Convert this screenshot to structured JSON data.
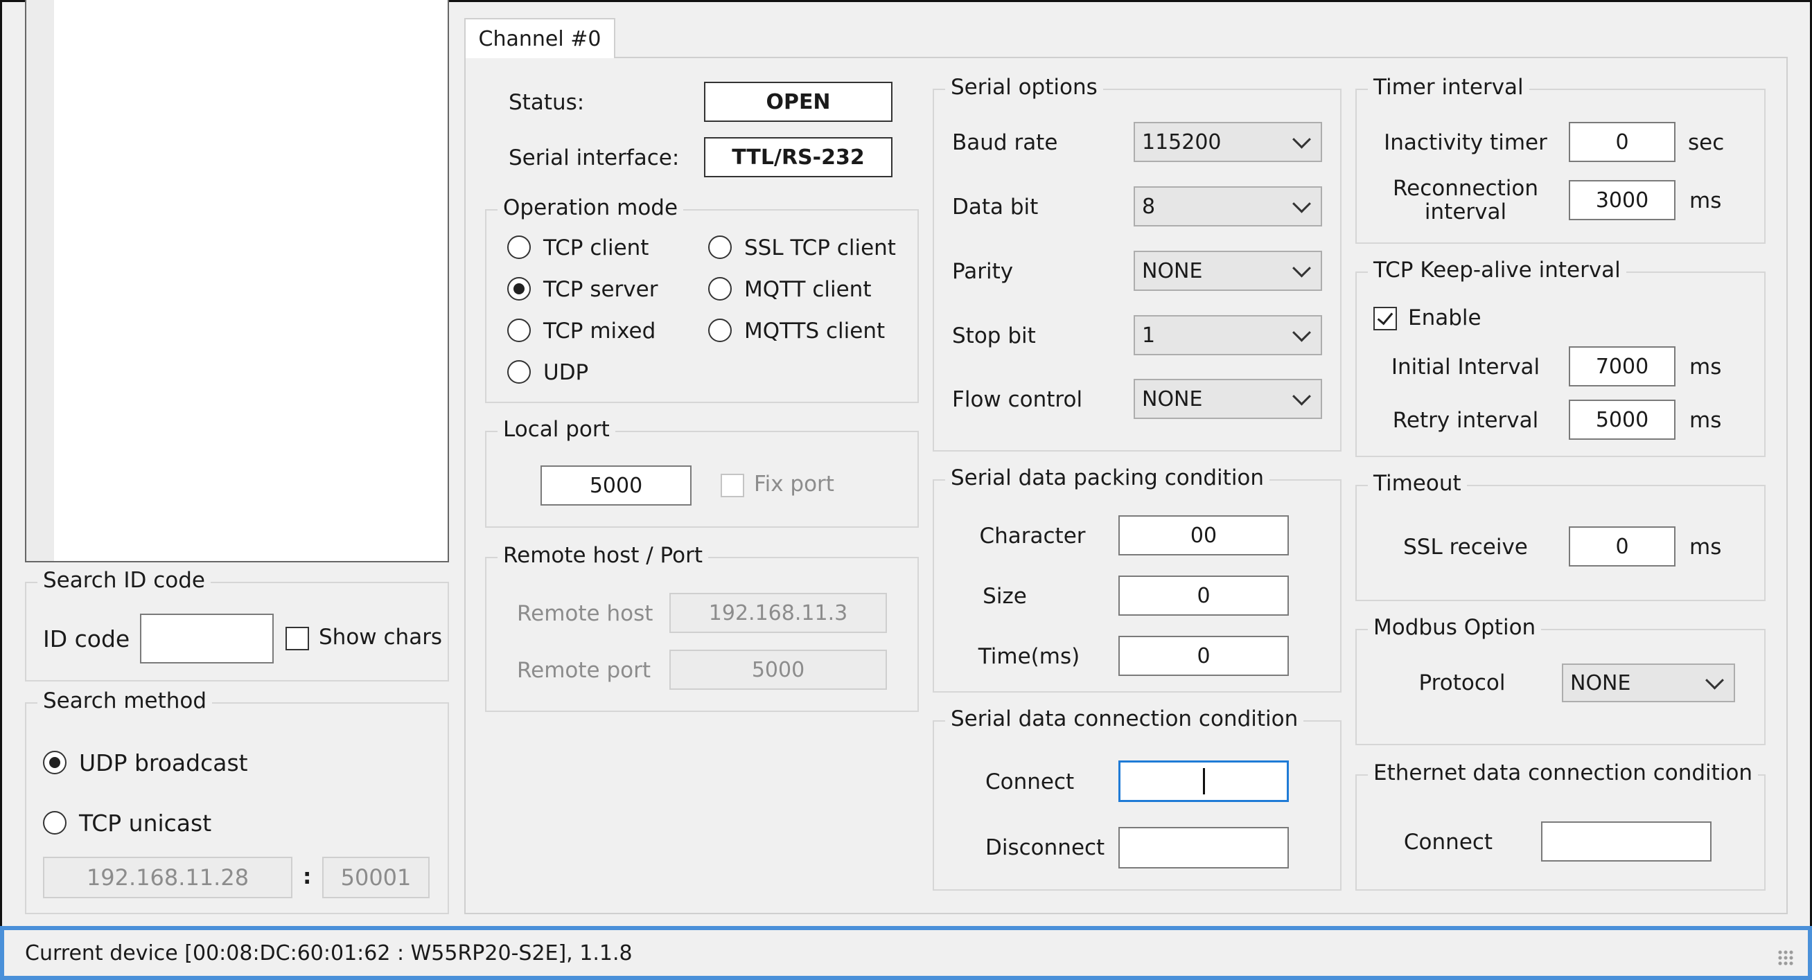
{
  "tab": {
    "label": "Channel #0"
  },
  "status_row": {
    "status_label": "Status:",
    "status_value": "OPEN",
    "serial_if_label": "Serial interface:",
    "serial_if_value": "TTL/RS-232"
  },
  "operation_mode": {
    "legend": "Operation mode",
    "options": [
      "TCP client",
      "SSL TCP client",
      "TCP server",
      "MQTT client",
      "TCP mixed",
      "MQTTS client",
      "UDP"
    ],
    "selected": "TCP server"
  },
  "local_port": {
    "legend": "Local port",
    "value": "5000",
    "fix_port_label": "Fix port"
  },
  "remote": {
    "legend": "Remote host / Port",
    "host_label": "Remote host",
    "host_value": "192.168.11.3",
    "port_label": "Remote port",
    "port_value": "5000"
  },
  "serial_options": {
    "legend": "Serial options",
    "baud_label": "Baud rate",
    "baud_value": "115200",
    "data_label": "Data bit",
    "data_value": "8",
    "parity_label": "Parity",
    "parity_value": "NONE",
    "stop_label": "Stop bit",
    "stop_value": "1",
    "flow_label": "Flow control",
    "flow_value": "NONE"
  },
  "packing": {
    "legend": "Serial data packing condition",
    "char_label": "Character",
    "char_value": "00",
    "size_label": "Size",
    "size_value": "0",
    "time_label": "Time(ms)",
    "time_value": "0"
  },
  "serial_conn": {
    "legend": "Serial data connection condition",
    "connect_label": "Connect",
    "connect_value": "",
    "disconnect_label": "Disconnect",
    "disconnect_value": ""
  },
  "timer": {
    "legend": "Timer interval",
    "inactivity_label": "Inactivity timer",
    "inactivity_value": "0",
    "inactivity_unit": "sec",
    "reconnect_label_1": "Reconnection",
    "reconnect_label_2": "interval",
    "reconnect_value": "3000",
    "reconnect_unit": "ms"
  },
  "keepalive": {
    "legend": "TCP Keep-alive interval",
    "enable_label": "Enable",
    "enabled": true,
    "initial_label": "Initial Interval",
    "initial_value": "7000",
    "initial_unit": "ms",
    "retry_label": "Retry interval",
    "retry_value": "5000",
    "retry_unit": "ms"
  },
  "timeout": {
    "legend": "Timeout",
    "ssl_label": "SSL receive",
    "ssl_value": "0",
    "ssl_unit": "ms"
  },
  "modbus": {
    "legend": "Modbus Option",
    "protocol_label": "Protocol",
    "protocol_value": "NONE"
  },
  "eth_conn": {
    "legend": "Ethernet data connection condition",
    "connect_label": "Connect",
    "connect_value": ""
  },
  "search_id": {
    "legend": "Search ID code",
    "id_label": "ID code",
    "id_value": "",
    "show_chars_label": "Show chars"
  },
  "search_method": {
    "legend": "Search method",
    "udp_label": "UDP broadcast",
    "tcp_label": "TCP unicast",
    "selected": "UDP broadcast",
    "ip_value": "192.168.11.28",
    "separator": ":",
    "port_value": "50001"
  },
  "statusbar": {
    "text": "Current device [00:08:DC:60:01:62 : W55RP20-S2E], 1.1.8"
  },
  "colors": {
    "accent_border": "#4a90d9",
    "focus_border": "#1f7bd6",
    "panel_bg": "#f0f0f0"
  }
}
